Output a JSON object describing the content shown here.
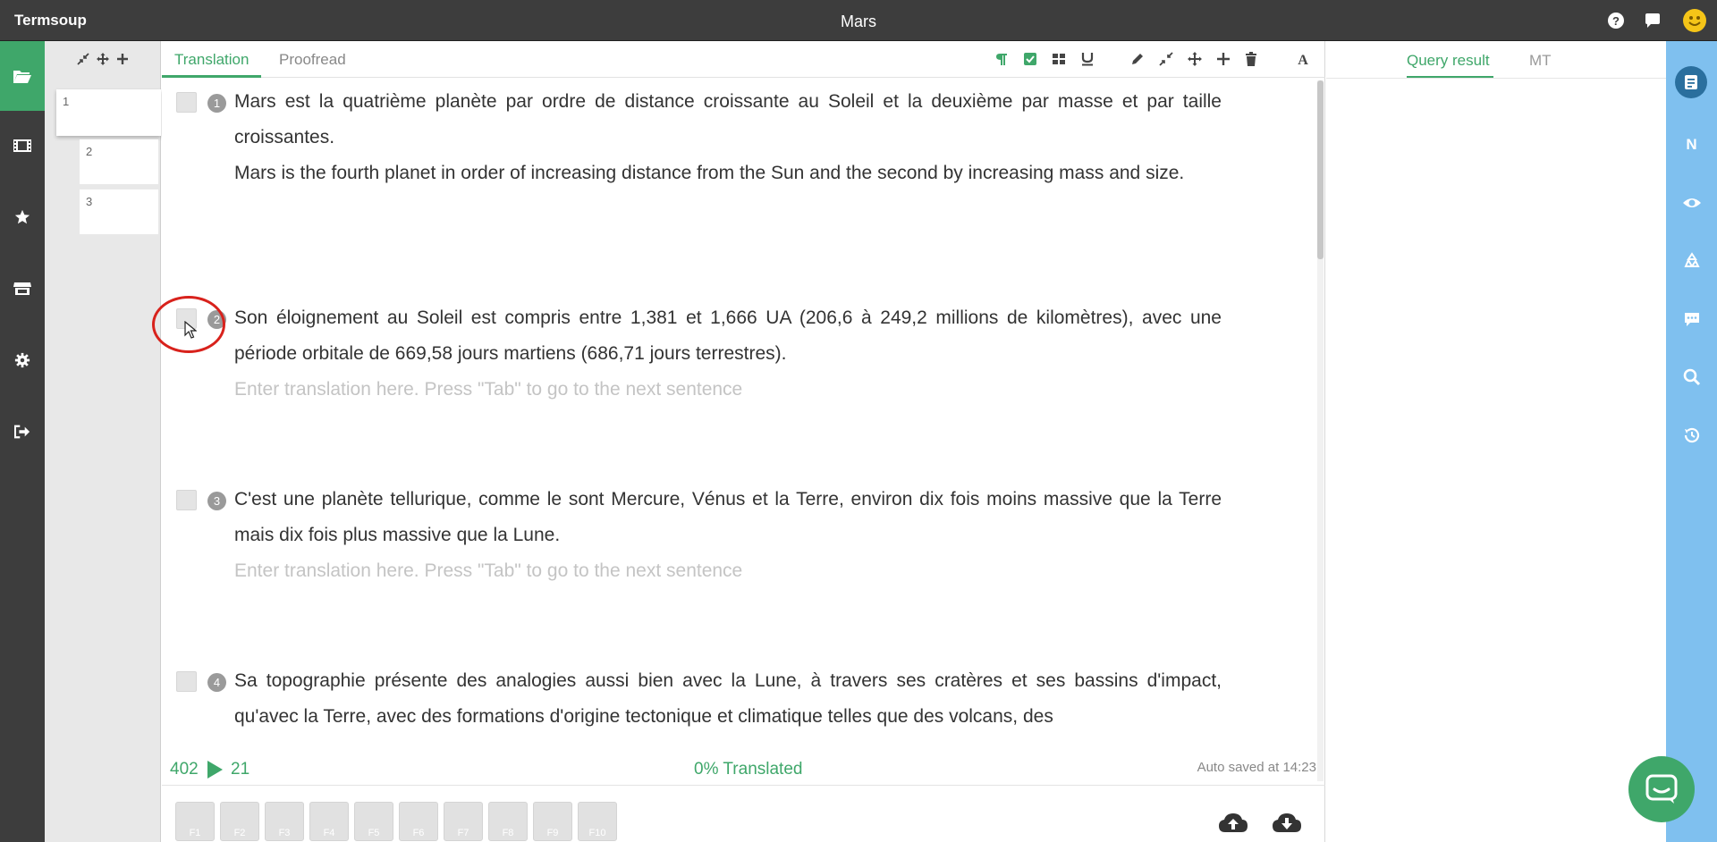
{
  "app": {
    "name": "Termsoup",
    "document_title": "Mars"
  },
  "titlebar_icons": [
    "help-icon",
    "chat-bubble-icon",
    "smiley-icon"
  ],
  "left_nav": [
    "folder-icon",
    "film-icon",
    "star-icon",
    "store-icon",
    "gear-icon",
    "logout-icon"
  ],
  "thumbnails": {
    "toolbar_icons": [
      "compress-icon",
      "move-icon",
      "plus-icon"
    ],
    "pages": [
      "1",
      "2",
      "3"
    ]
  },
  "editor": {
    "tabs": [
      "Translation",
      "Proofread"
    ],
    "active_tab": "Translation",
    "toolbar_icons": [
      "paragraph-icon",
      "checkbox-icon",
      "grid-icon",
      "underline-icon",
      "pencil-icon",
      "compress-icon",
      "move-icon",
      "plus-icon",
      "trash-icon",
      "font-icon"
    ],
    "segments": [
      {
        "number": "1",
        "source": "Mars est la quatrième planète par ordre de distance croissante au Soleil et la deuxième par masse et par taille croissantes.",
        "target": "Mars is the fourth planet in order of increasing distance from the Sun and the second by increasing mass and size."
      },
      {
        "number": "2",
        "source": "Son éloignement au Soleil est compris entre 1,381 et 1,666 UA (206,6 à 249,2 millions de kilomètres), avec une période orbitale de 669,58 jours martiens (686,71 jours terrestres).",
        "target": ""
      },
      {
        "number": "3",
        "source": "C'est une planète tellurique, comme le sont Mercure, Vénus et la Terre, environ dix fois moins massive que la Terre mais dix fois plus massive que la Lune.",
        "target": ""
      },
      {
        "number": "4",
        "source": "Sa topographie présente des analogies aussi bien avec la Lune, à travers ses cratères et ses bassins d'impact, qu'avec la Terre, avec des formations d'origine tectonique et climatique telles que des volcans, des",
        "target": ""
      }
    ],
    "target_placeholder": "Enter translation here. Press \"Tab\" to go to the next sentence",
    "status": {
      "count_left": "402",
      "count_right": "21",
      "progress_text": "0% Translated",
      "saved_text": "Auto saved at 14:23"
    },
    "function_keys": [
      "F1",
      "F2",
      "F3",
      "F4",
      "F5",
      "F6",
      "F7",
      "F8",
      "F9",
      "F10"
    ],
    "cloud_buttons": [
      "cloud-upload-icon",
      "cloud-download-icon"
    ]
  },
  "right_panel": {
    "tabs": [
      "Query result",
      "MT"
    ],
    "active_tab": "Query result"
  },
  "right_toolbar": [
    "notebook-icon",
    "N",
    "eye-icon",
    "recycle-icon",
    "comment-icon",
    "search-icon",
    "history-icon"
  ],
  "colors": {
    "accent": "#3fa76a",
    "dark": "#3d3d3d",
    "side_blue": "#7fc0ef",
    "highlight_circle": "#d8221c"
  }
}
